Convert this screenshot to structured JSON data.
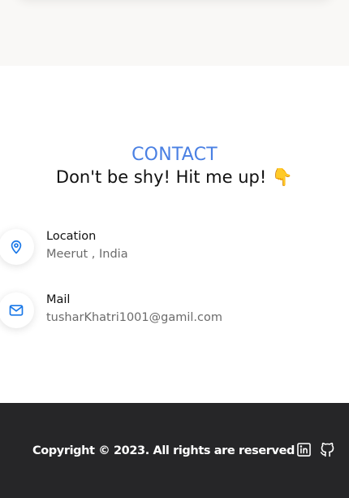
{
  "contact": {
    "eyebrow": "CONTACT",
    "heading": "Don't be shy! Hit me up! 👇",
    "items": [
      {
        "label": "Location",
        "value": "Meerut , India",
        "icon": "map-pin-icon"
      },
      {
        "label": "Mail",
        "value": "tusharKhatri1001@gamil.com",
        "icon": "mail-icon"
      }
    ]
  },
  "footer": {
    "copyright": "Copyright © 2023. All rights are reserved",
    "social": [
      {
        "icon": "linkedin-icon"
      },
      {
        "icon": "github-icon"
      }
    ]
  },
  "colors": {
    "accent": "#4a80e3",
    "icon_blue": "#1877e8",
    "footer_bg": "#262628",
    "top_band_bg": "#f9f8f6"
  }
}
